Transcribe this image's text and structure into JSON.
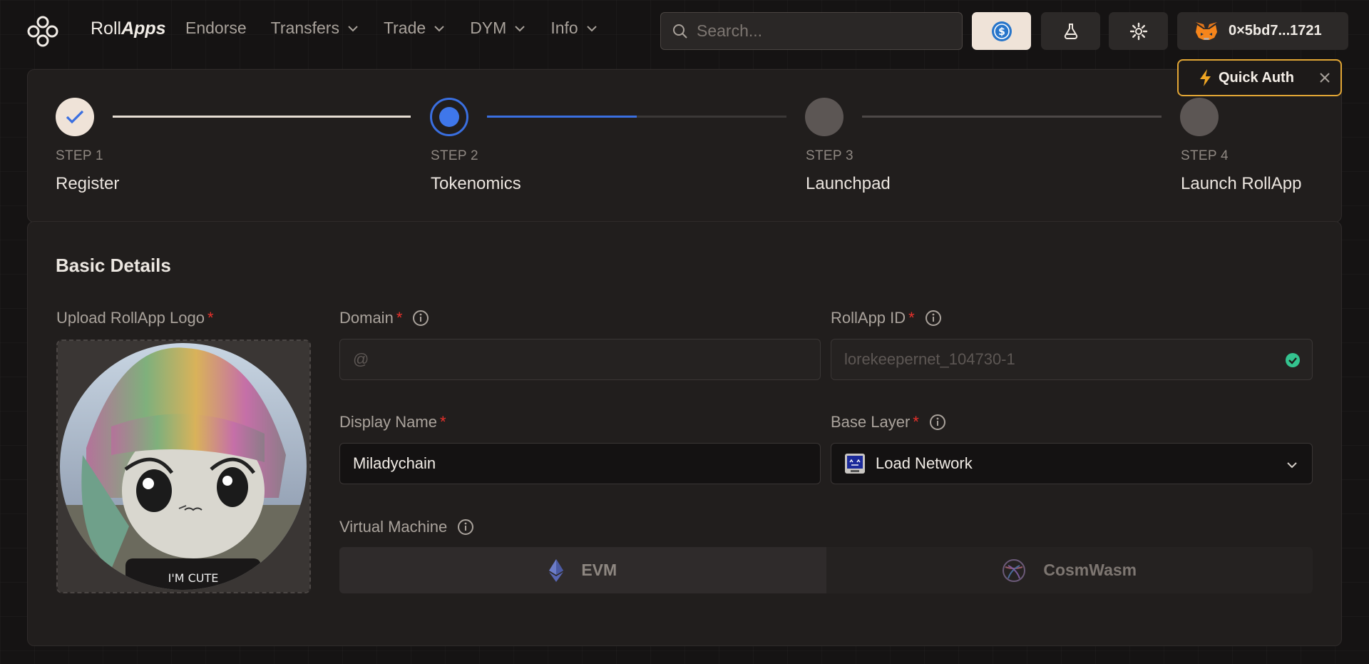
{
  "header": {
    "brand_plain": "Roll",
    "brand_italic": "Apps",
    "nav": [
      {
        "label": "Endorse",
        "has_dropdown": false
      },
      {
        "label": "Transfers",
        "has_dropdown": true
      },
      {
        "label": "Trade",
        "has_dropdown": true
      },
      {
        "label": "DYM",
        "has_dropdown": true
      },
      {
        "label": "Info",
        "has_dropdown": true
      }
    ],
    "search_placeholder": "Search...",
    "wallet_address": "0×5bd7...1721"
  },
  "quick_auth": {
    "label": "Quick Auth"
  },
  "stepper": {
    "steps": [
      {
        "step": "STEP 1",
        "title": "Register",
        "state": "completed"
      },
      {
        "step": "STEP 2",
        "title": "Tokenomics",
        "state": "active",
        "progress": 0.5
      },
      {
        "step": "STEP 3",
        "title": "Launchpad",
        "state": "pending"
      },
      {
        "step": "STEP 4",
        "title": "Launch RollApp",
        "state": "pending"
      }
    ]
  },
  "form": {
    "section_title": "Basic Details",
    "logo_label": "Upload RollApp Logo",
    "logo_caption": "I'M CUTE",
    "domain": {
      "label": "Domain",
      "placeholder": "@",
      "value": ""
    },
    "rollapp_id": {
      "label": "RollApp ID",
      "placeholder": "lorekeepernet_104730-1",
      "valid": true
    },
    "display_name": {
      "label": "Display Name",
      "value": "Miladychain"
    },
    "base_layer": {
      "label": "Base Layer",
      "value": "Load Network"
    },
    "virtual_machine": {
      "label": "Virtual Machine",
      "options": [
        "EVM",
        "CosmWasm"
      ],
      "selected": "EVM"
    },
    "required_mark": "*"
  },
  "colors": {
    "accent_blue": "#3a6fe0",
    "quick_auth_border": "#e2a635",
    "required": "#e8312b",
    "valid_check": "#34c38f"
  }
}
